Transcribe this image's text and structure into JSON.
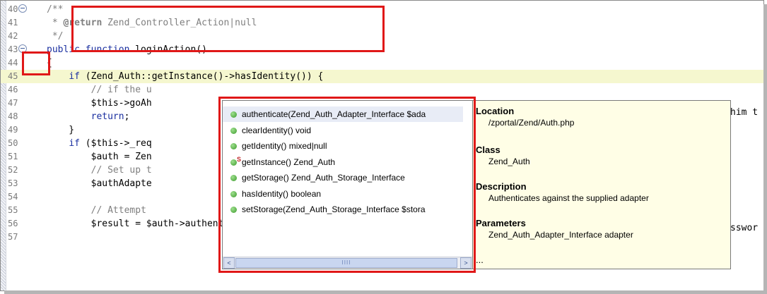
{
  "editor": {
    "lines": [
      {
        "num": "40",
        "fold": true,
        "html": "<span class='cm'>/**</span>"
      },
      {
        "num": "41",
        "fold": false,
        "html": "<span class='cm'> * </span><span class='tag'>@return</span><span class='cm'> Zend_Controller_Action|null</span>"
      },
      {
        "num": "42",
        "fold": false,
        "html": "<span class='cm'> */</span>"
      },
      {
        "num": "43",
        "fold": true,
        "html": "<span class='kw'>public function</span> loginAction()"
      },
      {
        "num": "44",
        "fold": false,
        "html": "{"
      },
      {
        "num": "45",
        "fold": false,
        "hl": true,
        "html": "    <span class='kw'>if</span> (Zend_Auth::getInstance()->hasIdentity()) {"
      },
      {
        "num": "46",
        "fold": false,
        "html": "        <span class='cm'>// if the u</span>"
      },
      {
        "num": "47",
        "fold": false,
        "html": "        $this->goAh"
      },
      {
        "num": "48",
        "fold": false,
        "html": "        <span class='kw'>return</span>;"
      },
      {
        "num": "49",
        "fold": false,
        "html": "    }"
      },
      {
        "num": "50",
        "fold": false,
        "html": "    <span class='kw'>if</span> ($this->_req"
      },
      {
        "num": "51",
        "fold": false,
        "html": "        $auth = Zen"
      },
      {
        "num": "52",
        "fold": false,
        "html": "        <span class='cm'>// Set up t</span>"
      },
      {
        "num": "53",
        "fold": false,
        "html": "        $authAdapte"
      },
      {
        "num": "54",
        "fold": false,
        "html": ""
      },
      {
        "num": "55",
        "fold": false,
        "html": "        <span class='cm'>// Attempt</span>"
      },
      {
        "num": "56",
        "fold": false,
        "html": "        $result = $auth->authenticate($authAdapter);"
      },
      {
        "num": "57",
        "fold": false,
        "html": ""
      }
    ],
    "right_fragments": {
      "line46": "him t",
      "line53": "sswor"
    }
  },
  "completion": {
    "items": [
      {
        "label": "authenticate(Zend_Auth_Adapter_Interface $ada",
        "selected": true,
        "static": false
      },
      {
        "label": "clearIdentity() void",
        "selected": false,
        "static": false
      },
      {
        "label": "getIdentity() mixed|null",
        "selected": false,
        "static": false
      },
      {
        "label": "getInstance() Zend_Auth",
        "selected": false,
        "static": true
      },
      {
        "label": "getStorage() Zend_Auth_Storage_Interface",
        "selected": false,
        "static": false
      },
      {
        "label": "hasIdentity() boolean",
        "selected": false,
        "static": false
      },
      {
        "label": "setStorage(Zend_Auth_Storage_Interface $stora",
        "selected": false,
        "static": false
      }
    ],
    "static_badge": "S",
    "scroll_left": "<",
    "scroll_right": ">",
    "thumb_grip": "IIII"
  },
  "info": {
    "location_heading": "Location",
    "location_value": "/zportal/Zend/Auth.php",
    "class_heading": "Class",
    "class_value": "Zend_Auth",
    "description_heading": "Description",
    "description_value": "Authenticates against the supplied adapter",
    "parameters_heading": "Parameters",
    "parameters_value": "Zend_Auth_Adapter_Interface adapter",
    "ellipsis": "..."
  },
  "colors": {
    "highlight": "#e01818",
    "current_line": "#f5f7cf",
    "info_bg": "#fffee6",
    "keyword": "#1a2fa0"
  }
}
